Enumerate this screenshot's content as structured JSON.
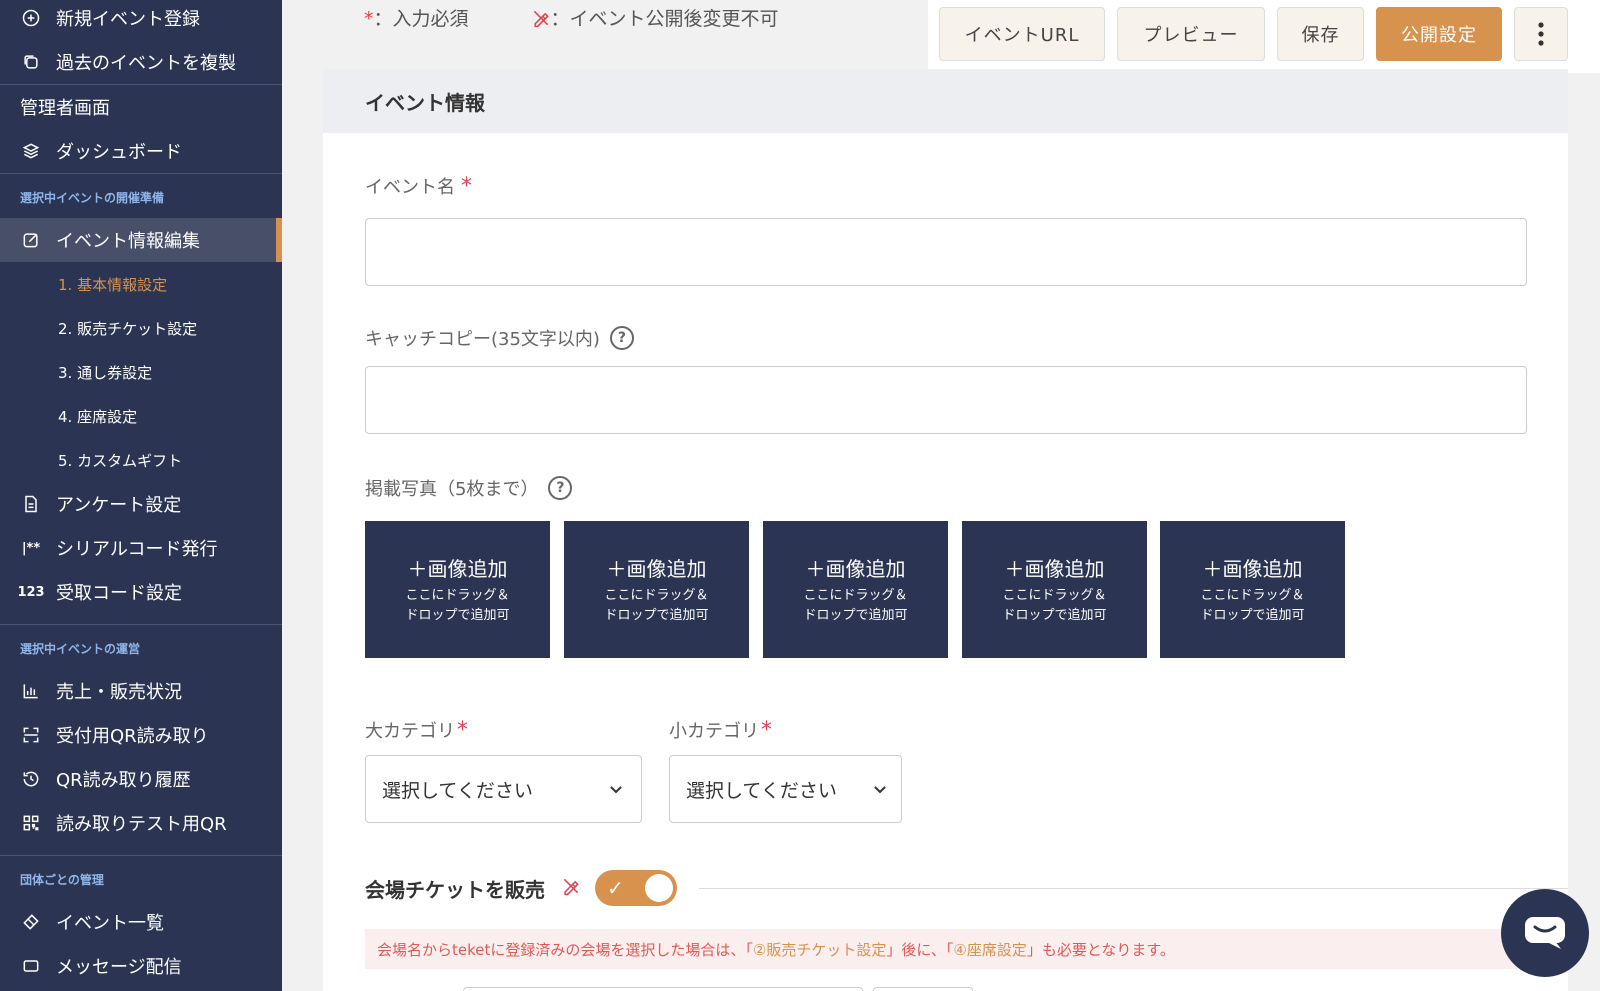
{
  "sidebar": {
    "top_items": [
      {
        "label": "新規イベント登録",
        "icon": "plus-circle-icon"
      },
      {
        "label": "過去のイベントを複製",
        "icon": "copy-icon"
      }
    ],
    "admin_label": "管理者画面",
    "dashboard": {
      "label": "ダッシュボード",
      "icon": "layers-icon"
    },
    "section_prep": "選択中イベントの開催準備",
    "event_edit": {
      "label": "イベント情報編集",
      "icon": "edit-icon"
    },
    "sub_items": [
      {
        "label": "1. 基本情報設定"
      },
      {
        "label": "2. 販売チケット設定"
      },
      {
        "label": "3. 通し券設定"
      },
      {
        "label": "4. 座席設定"
      },
      {
        "label": "5. カスタムギフト"
      }
    ],
    "prep_items": [
      {
        "label": "アンケート設定",
        "icon": "document-icon"
      },
      {
        "label": "シリアルコード発行",
        "icon": "serial-icon"
      },
      {
        "label": "受取コード設定",
        "icon": "123-icon",
        "icon_text": "123"
      }
    ],
    "section_ops": "選択中イベントの運営",
    "ops_items": [
      {
        "label": "売上・販売状況",
        "icon": "bar-chart-icon"
      },
      {
        "label": "受付用QR読み取り",
        "icon": "scan-icon"
      },
      {
        "label": "QR読み取り履歴",
        "icon": "history-icon"
      },
      {
        "label": "読み取りテスト用QR",
        "icon": "qr-icon"
      }
    ],
    "section_org": "団体ごとの管理",
    "org_items": [
      {
        "label": "イベント一覧",
        "icon": "ticket-icon"
      },
      {
        "label": "メッセージ配信",
        "icon": "message-icon"
      }
    ]
  },
  "legend": {
    "required_mark": "*",
    "required_text": "：入力必須",
    "locked_text": "：イベント公開後変更不可"
  },
  "toolbar": {
    "event_url": "イベントURL",
    "preview": "プレビュー",
    "save": "保存",
    "publish": "公開設定"
  },
  "card": {
    "title": "イベント情報",
    "event_name_label": "イベント名",
    "event_name_value": "",
    "catch_copy_label": "キャッチコピー(35文字以内)",
    "catch_copy_value": "",
    "photos_label": "掲載写真（5枚まで）",
    "photo_slot": {
      "title": "＋画像追加",
      "line1": "ここにドラッグ＆",
      "line2": "ドロップで追加可"
    },
    "major_category_label": "大カテゴリ",
    "minor_category_label": "小カテゴリ",
    "select_placeholder": "選択してください",
    "venue_ticket_label": "会場チケットを販売",
    "toggle_on": true,
    "notice_pre": "会場名からteketに登録済みの会場を選択した場合は、「",
    "notice_hl1": "②販売チケット設定",
    "notice_mid": "」後に、「",
    "notice_hl2": "④座席設定",
    "notice_post": "」も必要となります。"
  },
  "colors": {
    "sidebar_bg": "#2b3553",
    "accent": "#d7924d",
    "required": "#e0424f"
  }
}
